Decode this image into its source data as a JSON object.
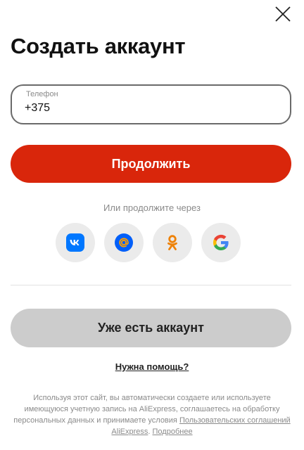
{
  "dialog": {
    "title": "Создать аккаунт",
    "close_icon": "close-icon"
  },
  "phone_field": {
    "label": "Телефон",
    "value": "+375"
  },
  "continue_button": {
    "label": "Продолжить",
    "color": "#d9260b"
  },
  "social": {
    "caption": "Или продолжите через",
    "providers": [
      {
        "name": "vk",
        "icon": "vk-icon",
        "color": "#0077ff"
      },
      {
        "name": "mail",
        "icon": "mail-ru-icon",
        "color": "#005ff9"
      },
      {
        "name": "ok",
        "icon": "odnoklassniki-icon",
        "color": "#ee8208"
      },
      {
        "name": "google",
        "icon": "google-icon",
        "color": "#4285f4"
      }
    ]
  },
  "login_button": {
    "label": "Уже есть аккаунт"
  },
  "help": {
    "label": "Нужна помощь?"
  },
  "legal": {
    "text_1": "Используя этот сайт, вы автоматически создаете или используете имеющуюся учетную запись на AliExpress, соглашаетесь на обработку персональных данных и принимаете условия",
    "link_agreements": "Пользовательских соглашений AliExpress",
    "separator": ".",
    "link_more": "Подробнее"
  }
}
